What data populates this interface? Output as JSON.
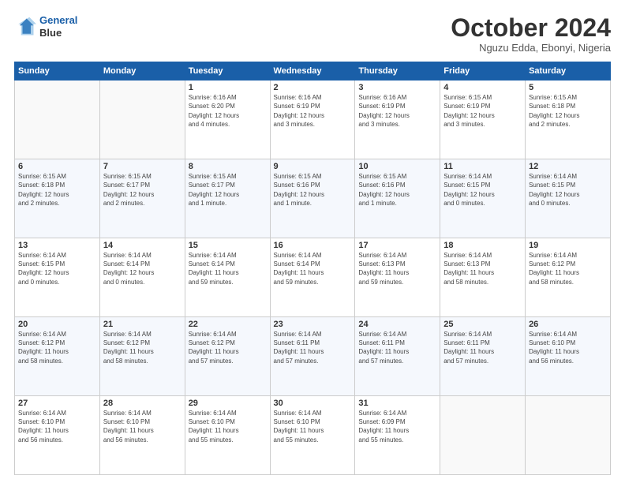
{
  "logo": {
    "line1": "General",
    "line2": "Blue"
  },
  "header": {
    "month": "October 2024",
    "location": "Nguzu Edda, Ebonyi, Nigeria"
  },
  "weekdays": [
    "Sunday",
    "Monday",
    "Tuesday",
    "Wednesday",
    "Thursday",
    "Friday",
    "Saturday"
  ],
  "weeks": [
    [
      {
        "day": "",
        "info": ""
      },
      {
        "day": "",
        "info": ""
      },
      {
        "day": "1",
        "info": "Sunrise: 6:16 AM\nSunset: 6:20 PM\nDaylight: 12 hours\nand 4 minutes."
      },
      {
        "day": "2",
        "info": "Sunrise: 6:16 AM\nSunset: 6:19 PM\nDaylight: 12 hours\nand 3 minutes."
      },
      {
        "day": "3",
        "info": "Sunrise: 6:16 AM\nSunset: 6:19 PM\nDaylight: 12 hours\nand 3 minutes."
      },
      {
        "day": "4",
        "info": "Sunrise: 6:15 AM\nSunset: 6:19 PM\nDaylight: 12 hours\nand 3 minutes."
      },
      {
        "day": "5",
        "info": "Sunrise: 6:15 AM\nSunset: 6:18 PM\nDaylight: 12 hours\nand 2 minutes."
      }
    ],
    [
      {
        "day": "6",
        "info": "Sunrise: 6:15 AM\nSunset: 6:18 PM\nDaylight: 12 hours\nand 2 minutes."
      },
      {
        "day": "7",
        "info": "Sunrise: 6:15 AM\nSunset: 6:17 PM\nDaylight: 12 hours\nand 2 minutes."
      },
      {
        "day": "8",
        "info": "Sunrise: 6:15 AM\nSunset: 6:17 PM\nDaylight: 12 hours\nand 1 minute."
      },
      {
        "day": "9",
        "info": "Sunrise: 6:15 AM\nSunset: 6:16 PM\nDaylight: 12 hours\nand 1 minute."
      },
      {
        "day": "10",
        "info": "Sunrise: 6:15 AM\nSunset: 6:16 PM\nDaylight: 12 hours\nand 1 minute."
      },
      {
        "day": "11",
        "info": "Sunrise: 6:14 AM\nSunset: 6:15 PM\nDaylight: 12 hours\nand 0 minutes."
      },
      {
        "day": "12",
        "info": "Sunrise: 6:14 AM\nSunset: 6:15 PM\nDaylight: 12 hours\nand 0 minutes."
      }
    ],
    [
      {
        "day": "13",
        "info": "Sunrise: 6:14 AM\nSunset: 6:15 PM\nDaylight: 12 hours\nand 0 minutes."
      },
      {
        "day": "14",
        "info": "Sunrise: 6:14 AM\nSunset: 6:14 PM\nDaylight: 12 hours\nand 0 minutes."
      },
      {
        "day": "15",
        "info": "Sunrise: 6:14 AM\nSunset: 6:14 PM\nDaylight: 11 hours\nand 59 minutes."
      },
      {
        "day": "16",
        "info": "Sunrise: 6:14 AM\nSunset: 6:14 PM\nDaylight: 11 hours\nand 59 minutes."
      },
      {
        "day": "17",
        "info": "Sunrise: 6:14 AM\nSunset: 6:13 PM\nDaylight: 11 hours\nand 59 minutes."
      },
      {
        "day": "18",
        "info": "Sunrise: 6:14 AM\nSunset: 6:13 PM\nDaylight: 11 hours\nand 58 minutes."
      },
      {
        "day": "19",
        "info": "Sunrise: 6:14 AM\nSunset: 6:12 PM\nDaylight: 11 hours\nand 58 minutes."
      }
    ],
    [
      {
        "day": "20",
        "info": "Sunrise: 6:14 AM\nSunset: 6:12 PM\nDaylight: 11 hours\nand 58 minutes."
      },
      {
        "day": "21",
        "info": "Sunrise: 6:14 AM\nSunset: 6:12 PM\nDaylight: 11 hours\nand 58 minutes."
      },
      {
        "day": "22",
        "info": "Sunrise: 6:14 AM\nSunset: 6:12 PM\nDaylight: 11 hours\nand 57 minutes."
      },
      {
        "day": "23",
        "info": "Sunrise: 6:14 AM\nSunset: 6:11 PM\nDaylight: 11 hours\nand 57 minutes."
      },
      {
        "day": "24",
        "info": "Sunrise: 6:14 AM\nSunset: 6:11 PM\nDaylight: 11 hours\nand 57 minutes."
      },
      {
        "day": "25",
        "info": "Sunrise: 6:14 AM\nSunset: 6:11 PM\nDaylight: 11 hours\nand 57 minutes."
      },
      {
        "day": "26",
        "info": "Sunrise: 6:14 AM\nSunset: 6:10 PM\nDaylight: 11 hours\nand 56 minutes."
      }
    ],
    [
      {
        "day": "27",
        "info": "Sunrise: 6:14 AM\nSunset: 6:10 PM\nDaylight: 11 hours\nand 56 minutes."
      },
      {
        "day": "28",
        "info": "Sunrise: 6:14 AM\nSunset: 6:10 PM\nDaylight: 11 hours\nand 56 minutes."
      },
      {
        "day": "29",
        "info": "Sunrise: 6:14 AM\nSunset: 6:10 PM\nDaylight: 11 hours\nand 55 minutes."
      },
      {
        "day": "30",
        "info": "Sunrise: 6:14 AM\nSunset: 6:10 PM\nDaylight: 11 hours\nand 55 minutes."
      },
      {
        "day": "31",
        "info": "Sunrise: 6:14 AM\nSunset: 6:09 PM\nDaylight: 11 hours\nand 55 minutes."
      },
      {
        "day": "",
        "info": ""
      },
      {
        "day": "",
        "info": ""
      }
    ]
  ]
}
